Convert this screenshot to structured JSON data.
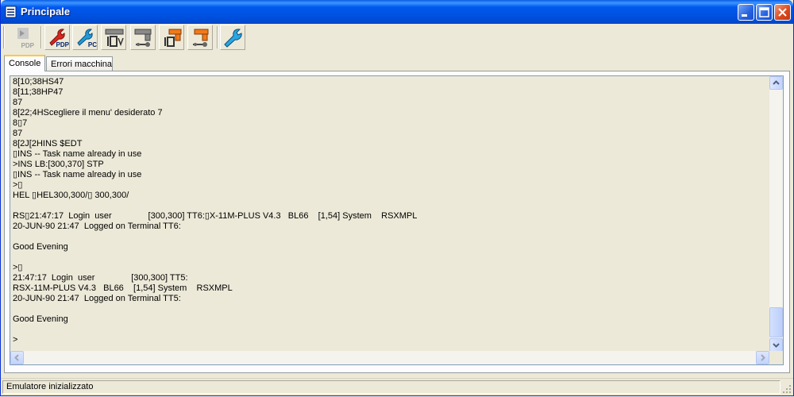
{
  "window": {
    "title": "Principale"
  },
  "toolbar": {
    "buttons": [
      {
        "name": "pdp-disabled",
        "label": "PDP"
      },
      {
        "name": "pdp-settings",
        "label": "PDP"
      },
      {
        "name": "pc-settings",
        "label": "PC"
      },
      {
        "name": "io-config",
        "label": ""
      },
      {
        "name": "connect",
        "label": ""
      },
      {
        "name": "io-orange",
        "label": ""
      },
      {
        "name": "connect-orange",
        "label": ""
      },
      {
        "name": "tools",
        "label": ""
      }
    ]
  },
  "tabs": [
    {
      "label": "Console",
      "active": true
    },
    {
      "label": "Errori macchina",
      "active": false
    }
  ],
  "console": {
    "lines": [
      "8[10;38HS47",
      "8[11;38HP47",
      "87",
      "8[22;4HScegliere il menu' desiderato 7",
      "8▯7",
      "87",
      "8[2J[2HINS $EDT",
      "▯INS -- Task name already in use",
      ">INS LB:[300,370] STP",
      "▯INS -- Task name already in use",
      ">▯",
      "HEL ▯HEL300,300/▯ 300,300/",
      "",
      "RS▯21:47:17  Login  user               [300,300] TT6:▯X-11M-PLUS V4.3   BL66    [1,54] System    RSXMPL",
      "20-JUN-90 21:47  Logged on Terminal TT6:",
      "",
      "Good Evening",
      "",
      ">▯",
      "21:47:17  Login  user               [300,300] TT5:",
      "RSX-11M-PLUS V4.3   BL66    [1,54] System    RSXMPL",
      "20-JUN-90 21:47  Logged on Terminal TT5:",
      "",
      "Good Evening",
      "",
      ">"
    ]
  },
  "status": {
    "text": "Emulatore inizializzato"
  },
  "colors": {
    "titlebar": "#0054E3",
    "face": "#ECE9D8",
    "accent_red": "#D9261C",
    "accent_blue": "#1F7FD0",
    "accent_orange": "#F07A1A"
  }
}
